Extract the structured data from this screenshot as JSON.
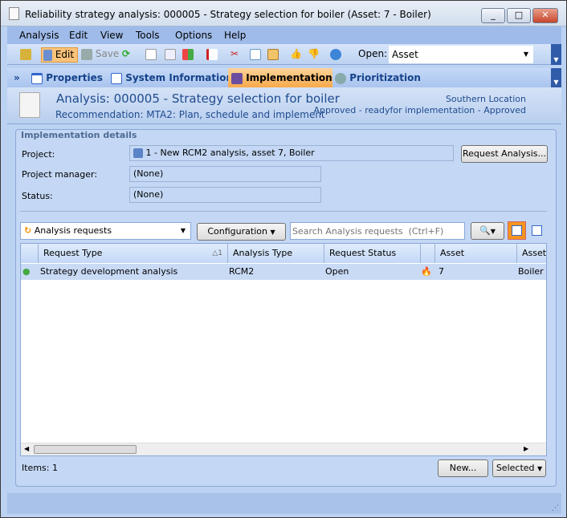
{
  "window": {
    "title": "Reliability strategy analysis: 000005 - Strategy selection for boiler (Asset: 7 - Boiler)"
  },
  "menu": [
    "Analysis",
    "Edit",
    "View",
    "Tools",
    "Options",
    "Help"
  ],
  "toolbar": {
    "edit": "Edit",
    "save": "Save",
    "open_label": "Open:",
    "open_value": "Asset"
  },
  "tabs": [
    "Properties",
    "System Information",
    "Implementation",
    "Prioritization"
  ],
  "active_tab": "Implementation",
  "header": {
    "title": "Analysis: 000005 - Strategy selection for boiler",
    "subtitle": "Recommendation: MTA2: Plan, schedule and implement",
    "location": "Southern Location",
    "status": "Approved - readyfor implementation - Approved"
  },
  "details": {
    "section": "Implementation details",
    "project_label": "Project:",
    "project_value": "1 - New RCM2 analysis, asset 7, Boiler",
    "request_button": "Request Analysis...",
    "manager_label": "Project manager:",
    "manager_value": "(None)",
    "status_label": "Status:",
    "status_value": "(None)"
  },
  "list": {
    "selector": "Analysis requests",
    "configuration": "Configuration",
    "search_placeholder": "Search Analysis requests  (Ctrl+F)",
    "sort_index": "1",
    "columns": [
      "Request Type",
      "Analysis Type",
      "Request Status",
      "",
      "Asset",
      "Asset"
    ],
    "rows": [
      {
        "request_type": "Strategy development analysis",
        "analysis_type": "RCM2",
        "request_status": "Open",
        "asset": "7",
        "asset_desc": "Boiler"
      }
    ]
  },
  "footer": {
    "items": "Items: 1",
    "new": "New...",
    "selected": "Selected"
  }
}
